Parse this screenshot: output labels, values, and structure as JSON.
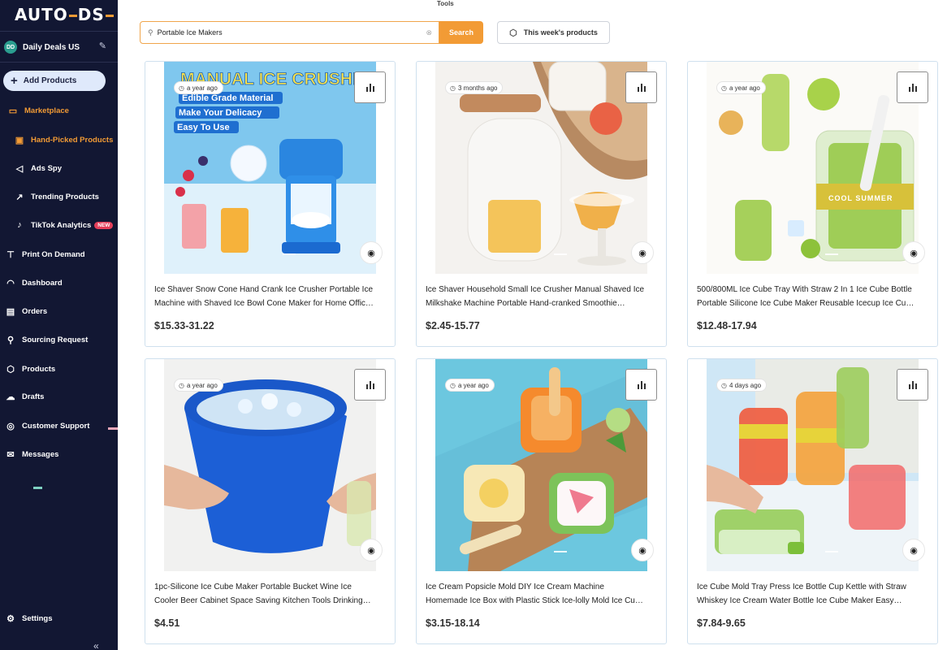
{
  "app": {
    "logo": "AUTO",
    "logo_suffix": "DS",
    "tools_title": "Tools"
  },
  "store": {
    "initials": "DD",
    "name": "Daily Deals US"
  },
  "sidebar": {
    "add_products": "Add Products",
    "marketplace": "Marketplace",
    "hand_picked": "Hand-Picked Products",
    "ads_spy": "Ads Spy",
    "trending": "Trending Products",
    "tiktok": "TikTok Analytics",
    "new_badge": "NEW",
    "print_on_demand": "Print On Demand",
    "dashboard": "Dashboard",
    "orders": "Orders",
    "sourcing": "Sourcing Request",
    "products": "Products",
    "drafts": "Drafts",
    "support": "Customer Support",
    "messages": "Messages",
    "settings": "Settings",
    "collapse": "«"
  },
  "search": {
    "value": "Portable Ice Makers",
    "button": "Search",
    "clear": "⊗"
  },
  "week_button": "This week's products",
  "colors": {
    "accent": "#f29b35",
    "sidebar_bg": "#121733",
    "new_badge": "#e43f5a"
  },
  "products": [
    {
      "age": "a year ago",
      "line1": "Ice Shaver Snow Cone Hand Crank Ice Crusher Portable Ice",
      "line2": "Machine with Shaved Ice Bowl Cone Maker for Home Offic…",
      "price": "$15.33-31.22",
      "image_text": [
        "MANUAL ICE CRUSHER",
        "Edible Grade Material",
        "Make Your Delicacy",
        "Easy To Use"
      ]
    },
    {
      "age": "3 months ago",
      "line1": "Ice Shaver Household Small Ice Crusher Manual Shaved Ice",
      "line2": "Milkshake Machine Portable Hand-cranked Smoothie…",
      "price": "$2.45-15.77"
    },
    {
      "age": "a year ago",
      "line1": "500/800ML Ice Cube Tray With Straw 2 In 1 Ice Cube Bottle",
      "line2": "Portable Silicone Ice Cube Maker Reusable Icecup Ice Cu…",
      "price": "$12.48-17.94",
      "image_text": [
        "COOL SUMMER"
      ]
    },
    {
      "age": "a year ago",
      "line1": "1pc-Silicone Ice Cube Maker Portable Bucket Wine Ice",
      "line2": "Cooler Beer Cabinet Space Saving Kitchen Tools Drinking…",
      "price": "$4.51"
    },
    {
      "age": "a year ago",
      "line1": "Ice Cream Popsicle Mold DIY Ice Cream Machine",
      "line2": "Homemade Ice Box with Plastic Stick Ice-lolly Mold Ice Cu…",
      "price": "$3.15-18.14"
    },
    {
      "age": "4 days ago",
      "line1": "Ice Cube Mold Tray Press Ice Bottle Cup Kettle with Straw",
      "line2": "Whiskey Ice Cream Water Bottle Ice Cube Maker Easy…",
      "price": "$7.84-9.65"
    }
  ]
}
